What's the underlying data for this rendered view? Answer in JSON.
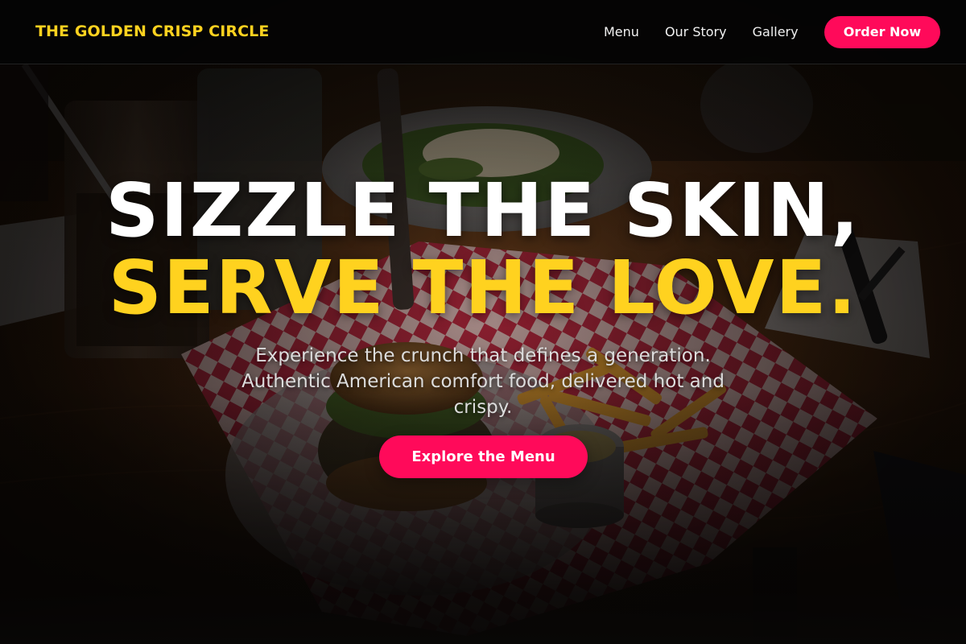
{
  "colors": {
    "brand_yellow": "#FFD21F",
    "accent_pink": "#FF0A5A",
    "nav_background": "#050505",
    "text_white": "#FFFFFF"
  },
  "navbar": {
    "brand": "THE GOLDEN CRISP CIRCLE",
    "links": [
      "Menu",
      "Our Story",
      "Gallery"
    ],
    "cta_label": "Order Now"
  },
  "hero": {
    "title_line1": "SIZZLE THE SKIN,",
    "title_line2": "SERVE THE LOVE.",
    "subtitle": "Experience the crunch that defines a generation. Authentic American comfort food, delivered hot and crispy.",
    "cta_label": "Explore the Menu"
  },
  "background": {
    "description_icon": "food-photo",
    "items": [
      "burger",
      "fries",
      "checkered-paper",
      "salad-plate",
      "drink-glasses",
      "cutlery",
      "napkin"
    ]
  }
}
